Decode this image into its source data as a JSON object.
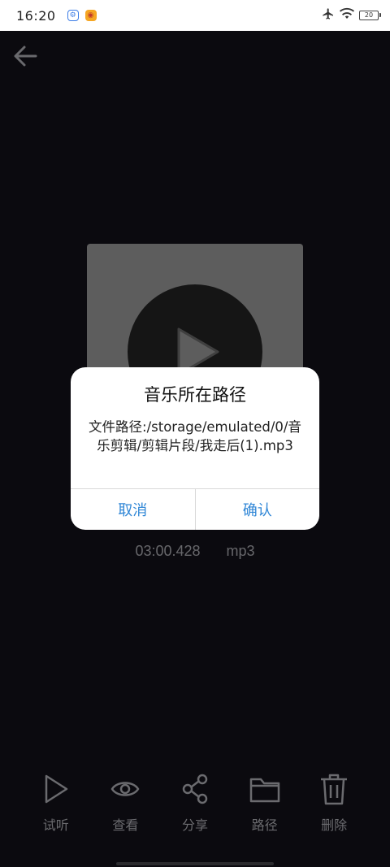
{
  "status_bar": {
    "time": "16:20",
    "battery": "20",
    "icons": [
      "baidu-icon",
      "weibo-icon",
      "airplane-icon",
      "wifi-icon",
      "battery-icon"
    ]
  },
  "media": {
    "duration": "03:00.428",
    "format": "mp3"
  },
  "dialog": {
    "title": "音乐所在路径",
    "message": "文件路径:/storage/emulated/0/音乐剪辑/剪辑片段/我走后(1).mp3",
    "cancel_label": "取消",
    "confirm_label": "确认"
  },
  "toolbar": {
    "items": [
      {
        "label": "试听",
        "icon": "play-icon"
      },
      {
        "label": "查看",
        "icon": "eye-icon"
      },
      {
        "label": "分享",
        "icon": "share-icon"
      },
      {
        "label": "路径",
        "icon": "folder-icon"
      },
      {
        "label": "删除",
        "icon": "trash-icon"
      }
    ]
  },
  "colors": {
    "background": "#0f0e14",
    "accent": "#2f86d6",
    "toolbar_icon": "#8f8f94"
  }
}
